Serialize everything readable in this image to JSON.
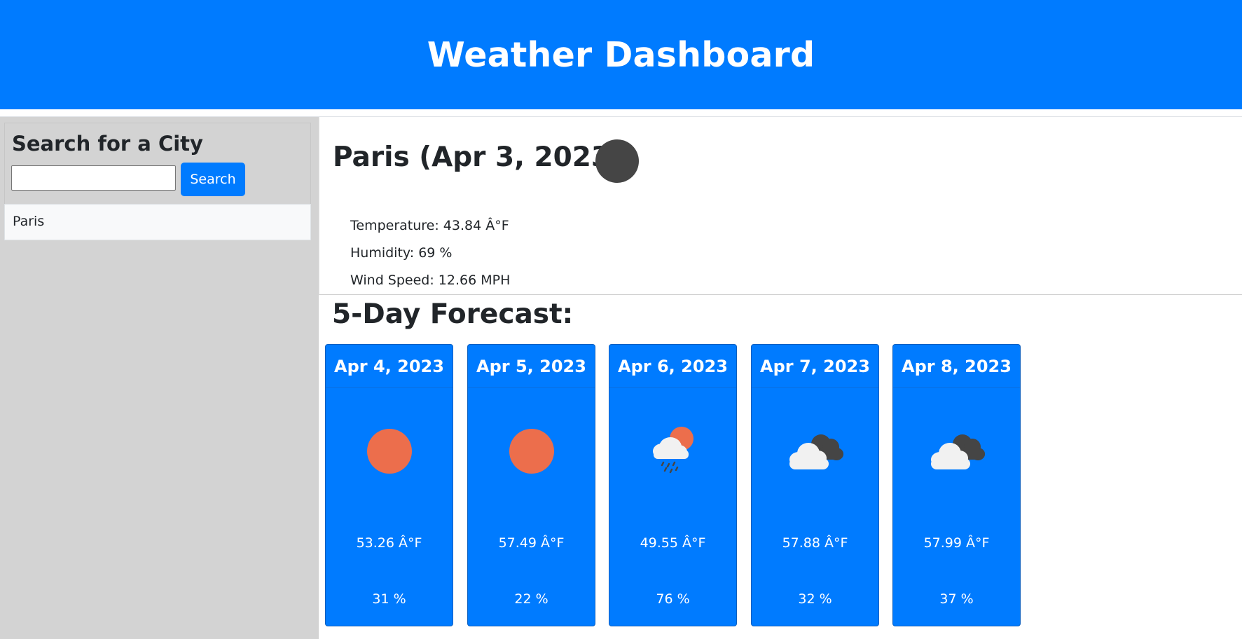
{
  "header": {
    "title": "Weather Dashboard"
  },
  "sidebar": {
    "search_title": "Search for a City",
    "search_input_value": "",
    "search_button_label": "Search",
    "history": [
      "Paris"
    ]
  },
  "current": {
    "title": "Paris (Apr 3, 2023)",
    "icon": "moon-icon",
    "temperature": "Temperature: 43.84 Â°F",
    "humidity": "Humidity: 69 %",
    "wind": "Wind Speed: 12.66 MPH"
  },
  "forecast": {
    "title": "5-Day Forecast:",
    "days": [
      {
        "date": "Apr 4, 2023",
        "icon": "sun-icon",
        "temp": "53.26 Â°F",
        "humidity": "31 %"
      },
      {
        "date": "Apr 5, 2023",
        "icon": "sun-icon",
        "temp": "57.49 Â°F",
        "humidity": "22 %"
      },
      {
        "date": "Apr 6, 2023",
        "icon": "rain-sun-cloud-icon",
        "temp": "49.55 Â°F",
        "humidity": "76 %"
      },
      {
        "date": "Apr 7, 2023",
        "icon": "broken-clouds-icon",
        "temp": "57.88 Â°F",
        "humidity": "32 %"
      },
      {
        "date": "Apr 8, 2023",
        "icon": "broken-clouds-icon",
        "temp": "57.99 Â°F",
        "humidity": "37 %"
      }
    ]
  },
  "colors": {
    "primary": "#007bff",
    "sidebar": "#d3d3d3",
    "sun": "#ec6e4c",
    "dark_cloud": "#454545",
    "light_cloud": "#f1f1f1"
  }
}
